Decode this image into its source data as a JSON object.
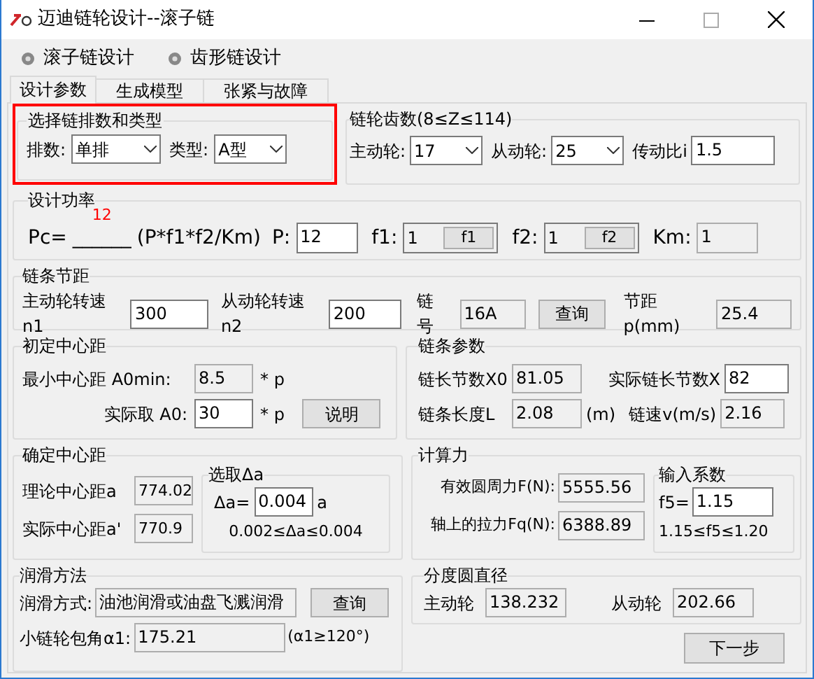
{
  "window": {
    "title": "迈迪链轮设计--滚子链"
  },
  "menu": [
    {
      "label": "滚子链设计"
    },
    {
      "label": "齿形链设计"
    }
  ],
  "tabs": [
    {
      "label": "设计参数",
      "selected": true
    },
    {
      "label": "生成模型",
      "selected": false
    },
    {
      "label": "张紧与故障",
      "selected": false
    }
  ],
  "chain_type": {
    "title": "选择链排数和类型",
    "highlighted": true,
    "rows_label": "排数:",
    "rows_value": "单排",
    "type_label": "类型:",
    "type_value": "A型"
  },
  "teeth": {
    "title": "链轮齿数(8≤Z≤114)",
    "driver_label": "主动轮:",
    "driver_value": "17",
    "driven_label": "从动轮:",
    "driven_value": "25",
    "ratio_label": "传动比i",
    "ratio_value": "1.5"
  },
  "power": {
    "title": "设计功率",
    "formula_prefix": "Pc=",
    "result": "12",
    "formula_blank": "______",
    "formula_suffix": "(P*f1*f2/Km)",
    "p_label": "P:",
    "p_value": "12",
    "f1_label": "f1:",
    "f1_value": "1",
    "f1_button": "f1",
    "f2_label": "f2:",
    "f2_value": "1",
    "f2_button": "f2",
    "km_label": "Km:",
    "km_value": "1"
  },
  "pitch": {
    "title": "链条节距",
    "n1_label": "主动轮转速n1",
    "n1_value": "300",
    "n2_label": "从动轮转速n2",
    "n2_value": "200",
    "chain_no_label": "链号",
    "chain_no_value": "16A",
    "query_button": "查询",
    "pitch_label": "节距p(mm)",
    "pitch_value": "25.4"
  },
  "initial_center": {
    "title": "初定中心距",
    "min_label": "最小中心距 A0min:",
    "min_value": "8.5",
    "min_unit": "* p",
    "actual_label": "实际取 A0:",
    "actual_value": "30",
    "actual_unit": "* p",
    "explain_button": "说明"
  },
  "chain_params": {
    "title": "链条参数",
    "x0_label": "链长节数X0",
    "x0_value": "81.05",
    "x_label": "实际链长节数X",
    "x_value": "82",
    "l_label": "链条长度L",
    "l_value": "2.08",
    "l_unit": "(m)",
    "v_label": "链速v(m/s)",
    "v_value": "2.16"
  },
  "center": {
    "title": "确定中心距",
    "theory_label": "理论中心距a",
    "theory_value": "774.02",
    "actual_label": "实际中心距a'",
    "actual_value": "770.9",
    "delta": {
      "title": "选取Δa",
      "label": "Δa=",
      "value": "0.004",
      "unit": "a",
      "range": "0.002≤Δa≤0.004"
    }
  },
  "force": {
    "title": "计算力",
    "f_label": "有效圆周力F(N):",
    "f_value": "5555.56",
    "fq_label": "轴上的拉力Fq(N):",
    "fq_value": "6388.89",
    "coef": {
      "title": "输入系数",
      "label": "f5=",
      "value": "1.15",
      "range": "1.15≤f5≤1.20"
    }
  },
  "lubrication": {
    "title": "润滑方法",
    "method_label": "润滑方式:",
    "method_value": "油池润滑或油盘飞溅润滑",
    "query_button": "查询",
    "angle_label": "小链轮包角α1:",
    "angle_value": "175.21",
    "angle_note": "(α1≥120°)"
  },
  "pitch_diameter": {
    "title": "分度圆直径",
    "driver_label": "主动轮",
    "driver_value": "138.232",
    "driven_label": "从动轮",
    "driven_value": "202.66"
  },
  "next_button": "下一步"
}
